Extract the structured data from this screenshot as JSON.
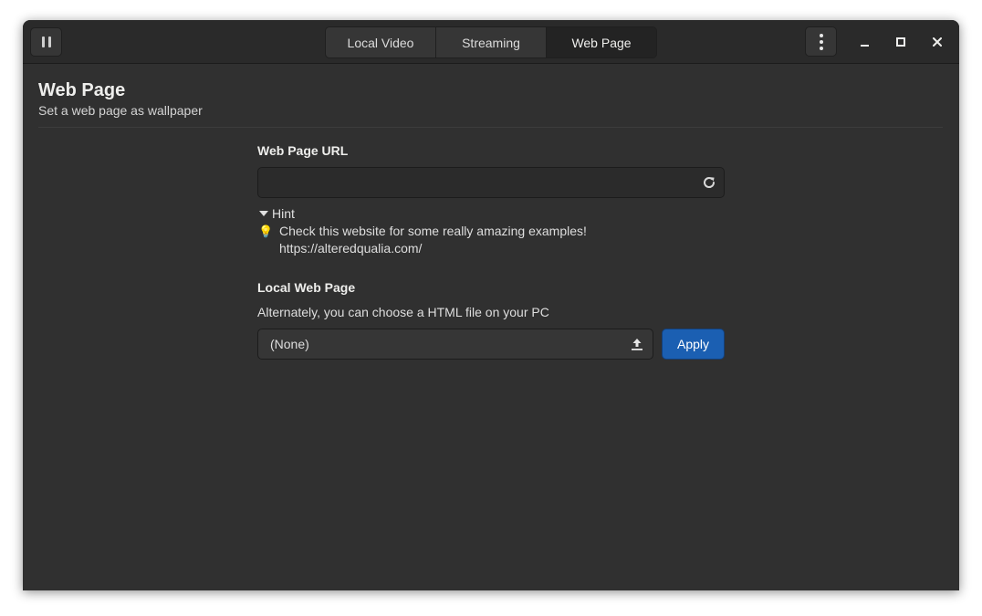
{
  "headerbar": {
    "tabs": [
      {
        "label": "Local Video",
        "active": false
      },
      {
        "label": "Streaming",
        "active": false
      },
      {
        "label": "Web Page",
        "active": true
      }
    ],
    "icons": {
      "pause": "pause-icon",
      "menu": "kebab-menu-icon",
      "minimize": "minimize-icon",
      "maximize": "maximize-icon",
      "close": "close-icon"
    }
  },
  "page": {
    "title": "Web Page",
    "subtitle": "Set a web page as wallpaper"
  },
  "url_section": {
    "label": "Web Page URL",
    "value": "",
    "placeholder": "",
    "refresh_icon": "refresh-icon"
  },
  "hint": {
    "label": "Hint",
    "expanded": true,
    "icon": "lightbulb-icon",
    "text": "Check this website for some really amazing examples!",
    "link": "https://alteredqualia.com/"
  },
  "local_section": {
    "label": "Local Web Page",
    "description": "Alternately, you can choose a HTML file on your PC",
    "file_value": "(None)",
    "upload_icon": "upload-icon",
    "apply_label": "Apply"
  },
  "colors": {
    "window_bg": "#303030",
    "headerbar_bg": "#2a2a2a",
    "accent": "#1b5fb2",
    "text": "#eeeeec"
  }
}
